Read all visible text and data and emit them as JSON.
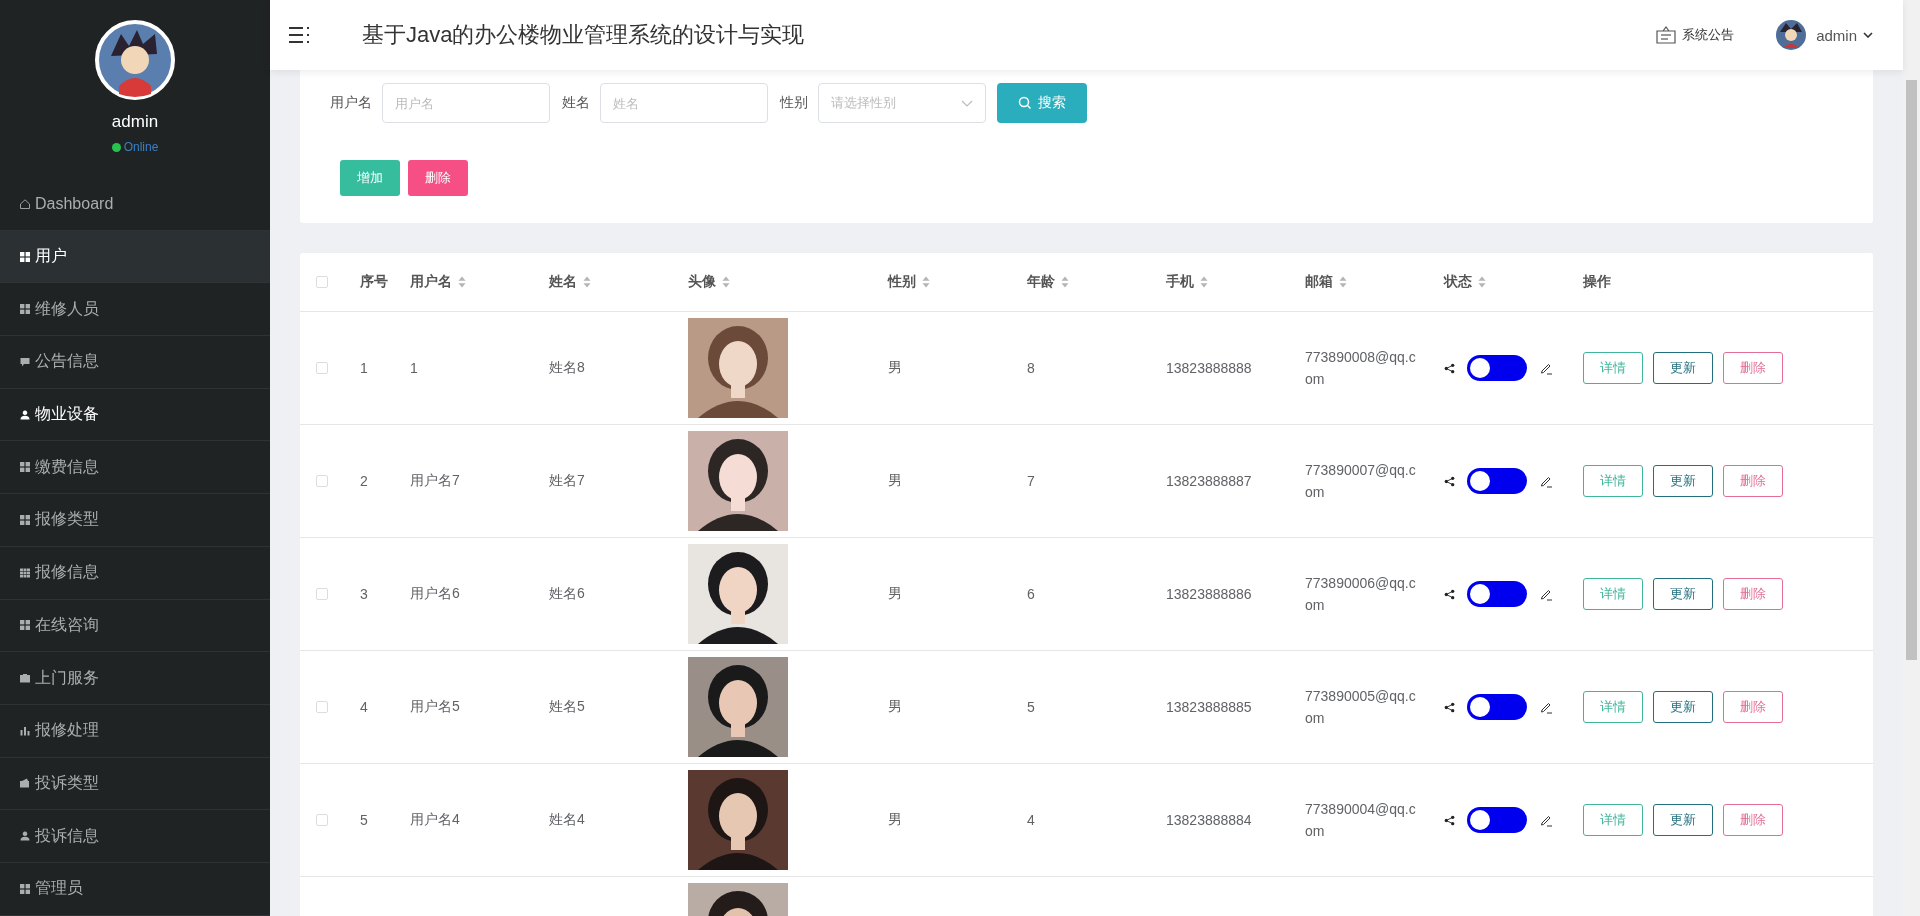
{
  "sidebar": {
    "user": {
      "name": "admin",
      "status": "Online"
    },
    "items": [
      {
        "label": "Dashboard",
        "selected": false,
        "hovered": false
      },
      {
        "label": "用户",
        "selected": true,
        "hovered": false
      },
      {
        "label": "维修人员",
        "selected": false,
        "hovered": false
      },
      {
        "label": "公告信息",
        "selected": false,
        "hovered": false
      },
      {
        "label": "物业设备",
        "selected": false,
        "hovered": true
      },
      {
        "label": "缴费信息",
        "selected": false,
        "hovered": false
      },
      {
        "label": "报修类型",
        "selected": false,
        "hovered": false
      },
      {
        "label": "报修信息",
        "selected": false,
        "hovered": false
      },
      {
        "label": "在线咨询",
        "selected": false,
        "hovered": false
      },
      {
        "label": "上门服务",
        "selected": false,
        "hovered": false
      },
      {
        "label": "报修处理",
        "selected": false,
        "hovered": false
      },
      {
        "label": "投诉类型",
        "selected": false,
        "hovered": false
      },
      {
        "label": "投诉信息",
        "selected": false,
        "hovered": false
      },
      {
        "label": "管理员",
        "selected": false,
        "hovered": false
      }
    ]
  },
  "header": {
    "title": "基于Java的办公楼物业管理系统的设计与实现",
    "notice": "系统公告",
    "user": "admin"
  },
  "search": {
    "fields": [
      {
        "label": "用户名",
        "placeholder": "用户名",
        "kind": "input"
      },
      {
        "label": "姓名",
        "placeholder": "姓名",
        "kind": "input"
      },
      {
        "label": "性别",
        "placeholder": "请选择性别",
        "kind": "select"
      }
    ],
    "button": "搜索",
    "actions": [
      "增加",
      "删除"
    ]
  },
  "table": {
    "select_all_checked": false,
    "columns": [
      {
        "label": "序号",
        "sortable": false
      },
      {
        "label": "用户名",
        "sortable": true
      },
      {
        "label": "姓名",
        "sortable": true
      },
      {
        "label": "头像",
        "sortable": true
      },
      {
        "label": "性别",
        "sortable": true
      },
      {
        "label": "年龄",
        "sortable": true
      },
      {
        "label": "手机",
        "sortable": true
      },
      {
        "label": "邮箱",
        "sortable": true
      },
      {
        "label": "状态",
        "sortable": true
      },
      {
        "label": "操作",
        "sortable": false
      }
    ],
    "rows": [
      {
        "index": "1",
        "username": "1",
        "name": "姓名8",
        "gender": "男",
        "age": "8",
        "phone": "13823888888",
        "email": "773890008@qq.com",
        "on": false,
        "checked": false,
        "buttons": [
          "详情",
          "更新",
          "删除"
        ]
      },
      {
        "index": "2",
        "username": "用户名7",
        "name": "姓名7",
        "gender": "男",
        "age": "7",
        "phone": "13823888887",
        "email": "773890007@qq.com",
        "on": false,
        "checked": false,
        "buttons": [
          "详情",
          "更新",
          "删除"
        ]
      },
      {
        "index": "3",
        "username": "用户名6",
        "name": "姓名6",
        "gender": "男",
        "age": "6",
        "phone": "13823888886",
        "email": "773890006@qq.com",
        "on": false,
        "checked": false,
        "buttons": [
          "详情",
          "更新",
          "删除"
        ]
      },
      {
        "index": "4",
        "username": "用户名5",
        "name": "姓名5",
        "gender": "男",
        "age": "5",
        "phone": "13823888885",
        "email": "773890005@qq.com",
        "on": false,
        "checked": false,
        "buttons": [
          "详情",
          "更新",
          "删除"
        ]
      },
      {
        "index": "5",
        "username": "用户名4",
        "name": "姓名4",
        "gender": "男",
        "age": "4",
        "phone": "13823888884",
        "email": "773890004@qq.com",
        "on": false,
        "checked": false,
        "buttons": [
          "详情",
          "更新",
          "删除"
        ]
      }
    ]
  }
}
